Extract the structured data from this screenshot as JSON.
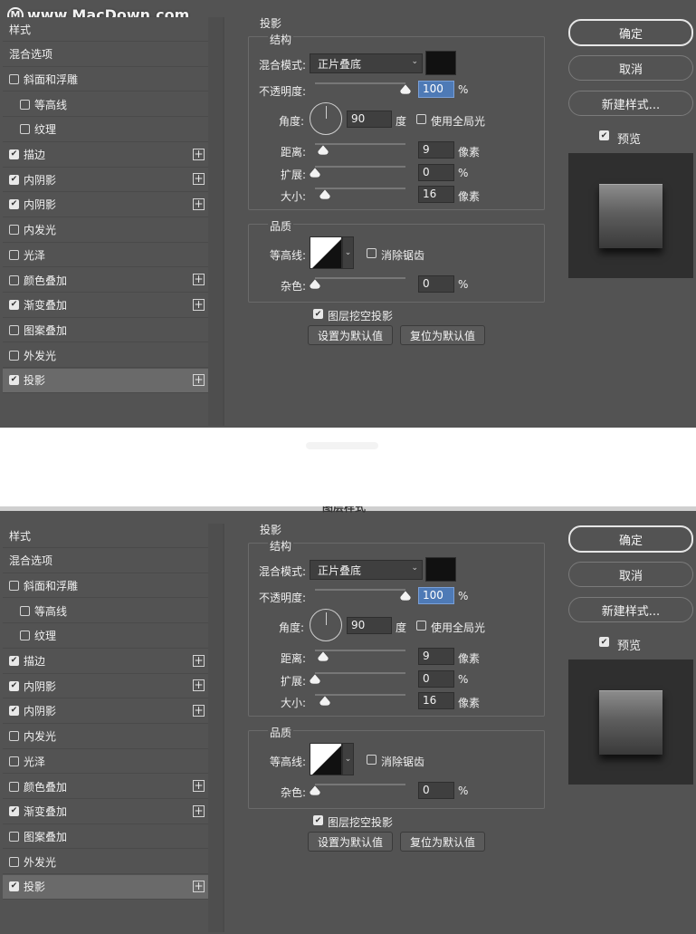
{
  "watermark": {
    "text": "www.MacDown.com",
    "icon": "M"
  },
  "dialog_title": "图层样式",
  "style_list": [
    {
      "label": "样式",
      "checkbox": "none",
      "plus": false,
      "indent": false,
      "selected": false
    },
    {
      "label": "混合选项",
      "checkbox": "none",
      "plus": false,
      "indent": false,
      "selected": false
    },
    {
      "label": "斜面和浮雕",
      "checkbox": "unchecked",
      "plus": false,
      "indent": false,
      "selected": false
    },
    {
      "label": "等高线",
      "checkbox": "unchecked",
      "plus": false,
      "indent": true,
      "selected": false
    },
    {
      "label": "纹理",
      "checkbox": "unchecked",
      "plus": false,
      "indent": true,
      "selected": false
    },
    {
      "label": "描边",
      "checkbox": "checked",
      "plus": true,
      "indent": false,
      "selected": false
    },
    {
      "label": "内阴影",
      "checkbox": "checked",
      "plus": true,
      "indent": false,
      "selected": false
    },
    {
      "label": "内阴影",
      "checkbox": "checked",
      "plus": true,
      "indent": false,
      "selected": false
    },
    {
      "label": "内发光",
      "checkbox": "unchecked",
      "plus": false,
      "indent": false,
      "selected": false
    },
    {
      "label": "光泽",
      "checkbox": "unchecked",
      "plus": false,
      "indent": false,
      "selected": false
    },
    {
      "label": "颜色叠加",
      "checkbox": "unchecked",
      "plus": true,
      "indent": false,
      "selected": false
    },
    {
      "label": "渐变叠加",
      "checkbox": "checked",
      "plus": true,
      "indent": false,
      "selected": false
    },
    {
      "label": "图案叠加",
      "checkbox": "unchecked",
      "plus": false,
      "indent": false,
      "selected": false
    },
    {
      "label": "外发光",
      "checkbox": "unchecked",
      "plus": false,
      "indent": false,
      "selected": false
    },
    {
      "label": "投影",
      "checkbox": "checked",
      "plus": true,
      "indent": false,
      "selected": true
    }
  ],
  "drop_shadow": {
    "section_title": "投影",
    "structure_title": "结构",
    "blend_mode_label": "混合模式:",
    "blend_mode_value": "正片叠底",
    "swatch_color": "#111111",
    "opacity_label": "不透明度:",
    "opacity_value": "100",
    "opacity_unit": "%",
    "angle_label": "角度:",
    "angle_value": "90",
    "angle_unit": "度",
    "global_light_label": "使用全局光",
    "global_light_checked": false,
    "distance_label": "距离:",
    "distance_value": "9",
    "distance_unit": "像素",
    "spread_label": "扩展:",
    "spread_value": "0",
    "spread_unit": "%",
    "size_label": "大小:",
    "size_value": "16",
    "size_unit": "像素",
    "quality_title": "品质",
    "contour_label": "等高线:",
    "antialias_label": "消除锯齿",
    "antialias_checked": false,
    "noise_label": "杂色:",
    "noise_value": "0",
    "noise_unit": "%",
    "knockout_label": "图层挖空投影",
    "knockout_checked": true,
    "set_default_label": "设置为默认值",
    "reset_default_label": "复位为默认值"
  },
  "buttons": {
    "ok": "确定",
    "cancel": "取消",
    "new_style": "新建样式...",
    "preview_label": "预览",
    "preview_checked": true
  },
  "sliders": {
    "opacity": 1.0,
    "distance": 0.09,
    "spread": 0.0,
    "size": 0.11,
    "noise": 0.0
  }
}
